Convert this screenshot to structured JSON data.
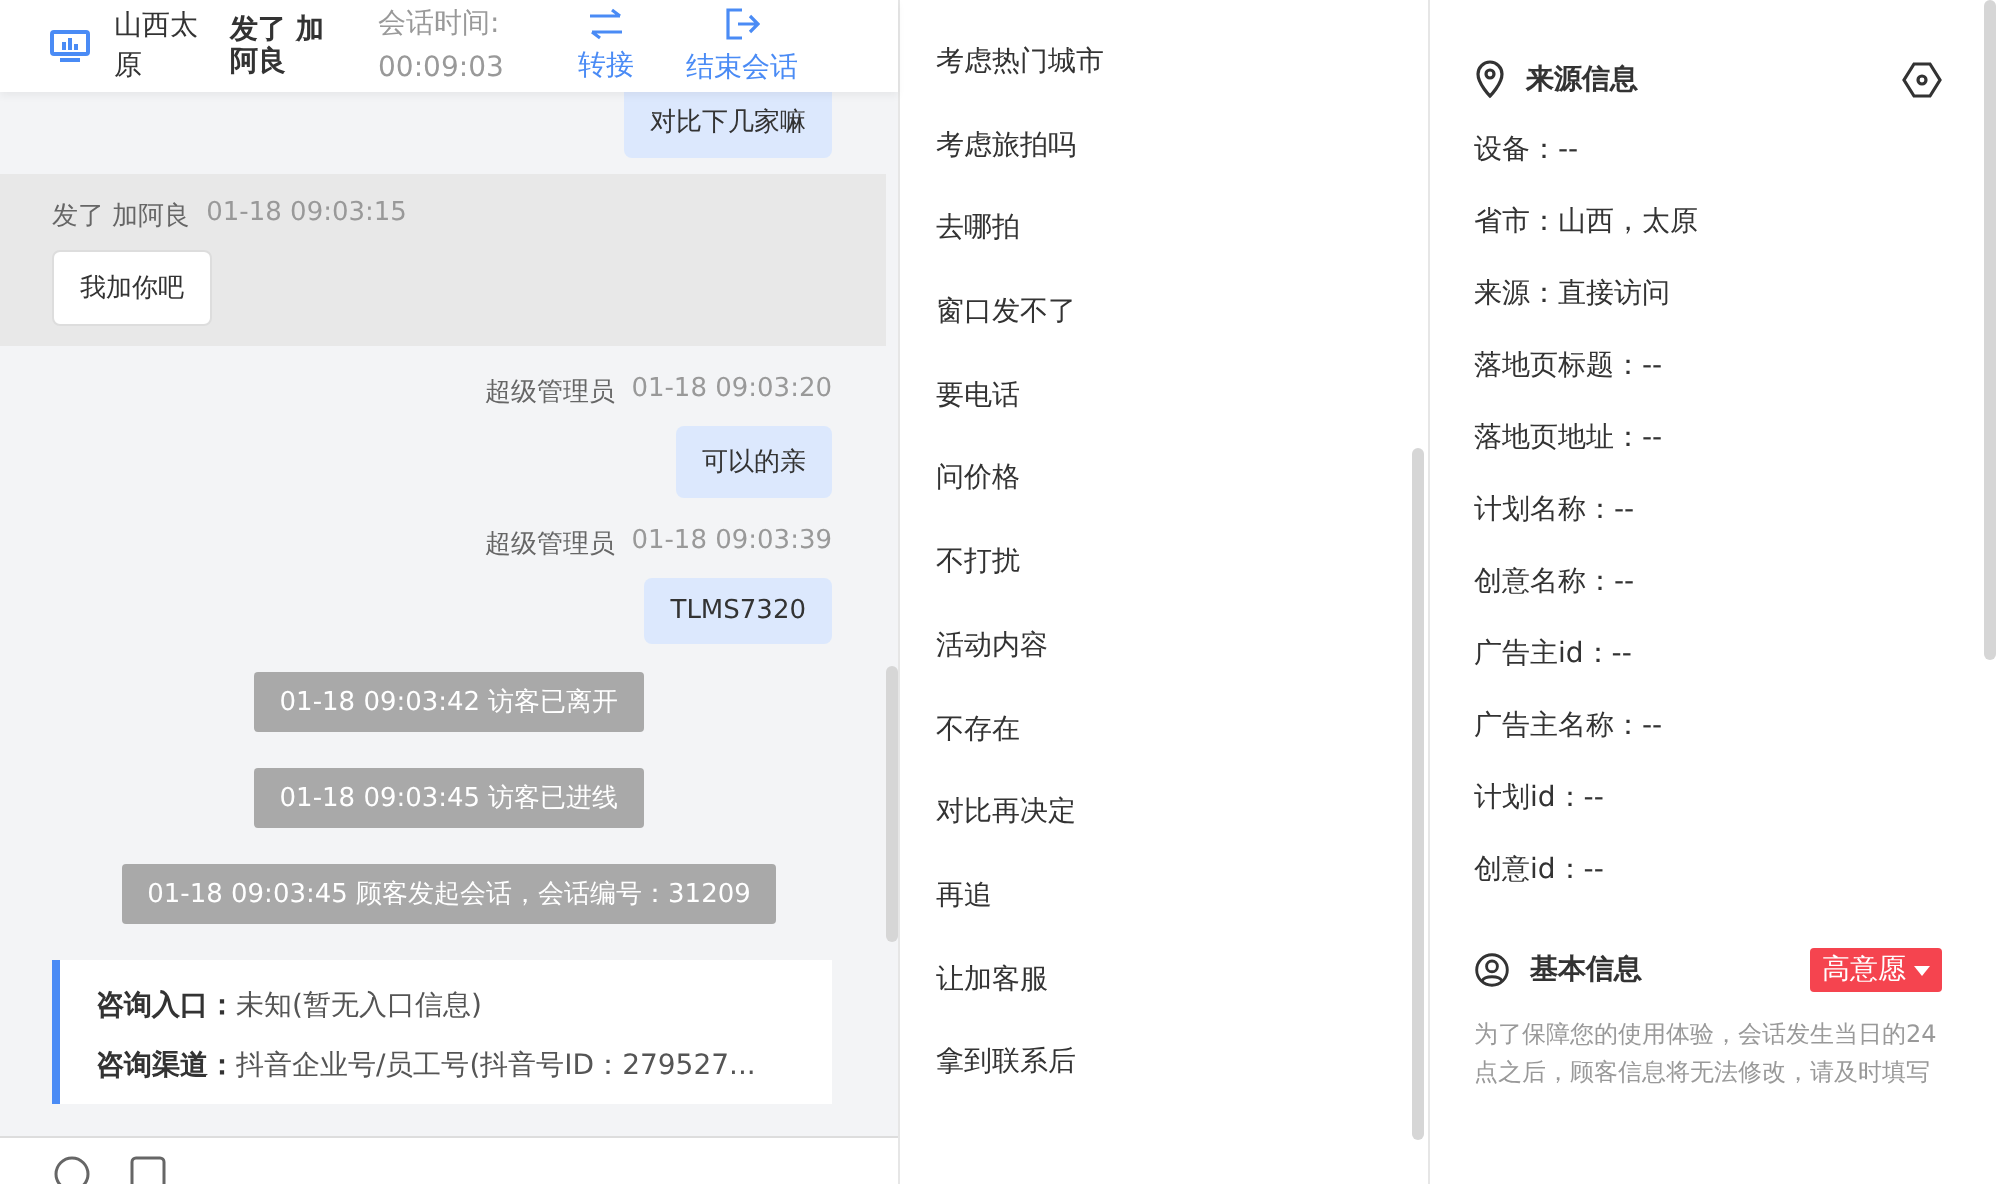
{
  "header": {
    "location": "山西太原",
    "visitor": "发了 加阿良",
    "duration_label": "会话时间:",
    "duration": "00:09:03",
    "actions": [
      {
        "kind": "transfer",
        "label": "转接"
      },
      {
        "kind": "end",
        "label": "结束会话"
      }
    ]
  },
  "messages": [
    {
      "kind": "agent",
      "text": "对比下几家嘛"
    },
    {
      "kind": "visitor",
      "sender": "发了 加阿良",
      "time": "01-18 09:03:15",
      "text": "我加你吧",
      "highlighted": true
    },
    {
      "kind": "agent",
      "sender": "超级管理员",
      "time": "01-18 09:03:20",
      "text": "可以的亲"
    },
    {
      "kind": "agent",
      "sender": "超级管理员",
      "time": "01-18 09:03:39",
      "text": "TLMS7320"
    },
    {
      "kind": "system",
      "text": "01-18 09:03:42 访客已离开"
    },
    {
      "kind": "system",
      "text": "01-18 09:03:45 访客已进线"
    },
    {
      "kind": "system",
      "text": "01-18 09:03:45 顾客发起会话，会话编号：31209"
    },
    {
      "kind": "entry",
      "rows": [
        {
          "label": "咨询入口：",
          "value": "未知(暂无入口信息)"
        },
        {
          "label": "咨询渠道：",
          "value": "抖音企业号/员工号(抖音号ID：279527..."
        }
      ]
    }
  ],
  "quick_replies": [
    "考虑热门城市",
    "考虑旅拍吗",
    "去哪拍",
    "窗口发不了",
    "要电话",
    "问价格",
    "不打扰",
    "活动内容",
    "不存在",
    "对比再决定",
    "再追",
    "让加客服",
    "拿到联系后"
  ],
  "source_info": {
    "title": "来源信息",
    "fields": [
      "设备：--",
      "省市：山西，太原",
      "来源：直接访问",
      "落地页标题：--",
      "落地页地址：--",
      "计划名称：--",
      "创意名称：--",
      "广告主id：--",
      "广告主名称：--",
      "计划id：--",
      "创意id：--"
    ]
  },
  "basic_info": {
    "title": "基本信息",
    "intent_tag": {
      "label": "高意愿",
      "color": "#f5444f"
    },
    "notice": "为了保障您的使用体验，会话发生当日的24点之后，顾客信息将无法修改，请及时填写"
  }
}
